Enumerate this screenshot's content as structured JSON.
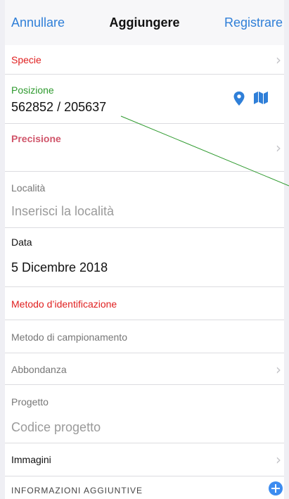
{
  "nav": {
    "cancel": "Annullare",
    "title": "Aggiungere",
    "save": "Registrare"
  },
  "form": {
    "species": {
      "label": "Specie"
    },
    "position": {
      "label": "Posizione",
      "value": "562852 / 205637"
    },
    "precision": {
      "label": "Precisione"
    },
    "locality": {
      "label": "Località",
      "placeholder": "Inserisci la località"
    },
    "date": {
      "label": "Data",
      "value": "5 Dicembre 2018"
    },
    "identification_method": {
      "label": "Metodo d’identificazione"
    },
    "sampling_method": {
      "label": "Metodo di campionamento"
    },
    "abundance": {
      "label": "Abbondanza"
    },
    "project": {
      "label": "Progetto",
      "placeholder": "Codice progetto"
    },
    "images": {
      "label": "Immagini"
    },
    "additional_info": {
      "label": "INFORMAZIONI AGGIUNTIVE"
    }
  },
  "icons": {
    "chevron": "›",
    "location_pin": "location-pin-icon",
    "map": "map-icon",
    "add": "add-circle-icon"
  },
  "colors": {
    "accent": "#2f7fd8",
    "required_red": "#e02020",
    "position_green": "#2e9a2e",
    "precision_pink": "#d0556a",
    "add_blue": "#3d8cf0"
  }
}
